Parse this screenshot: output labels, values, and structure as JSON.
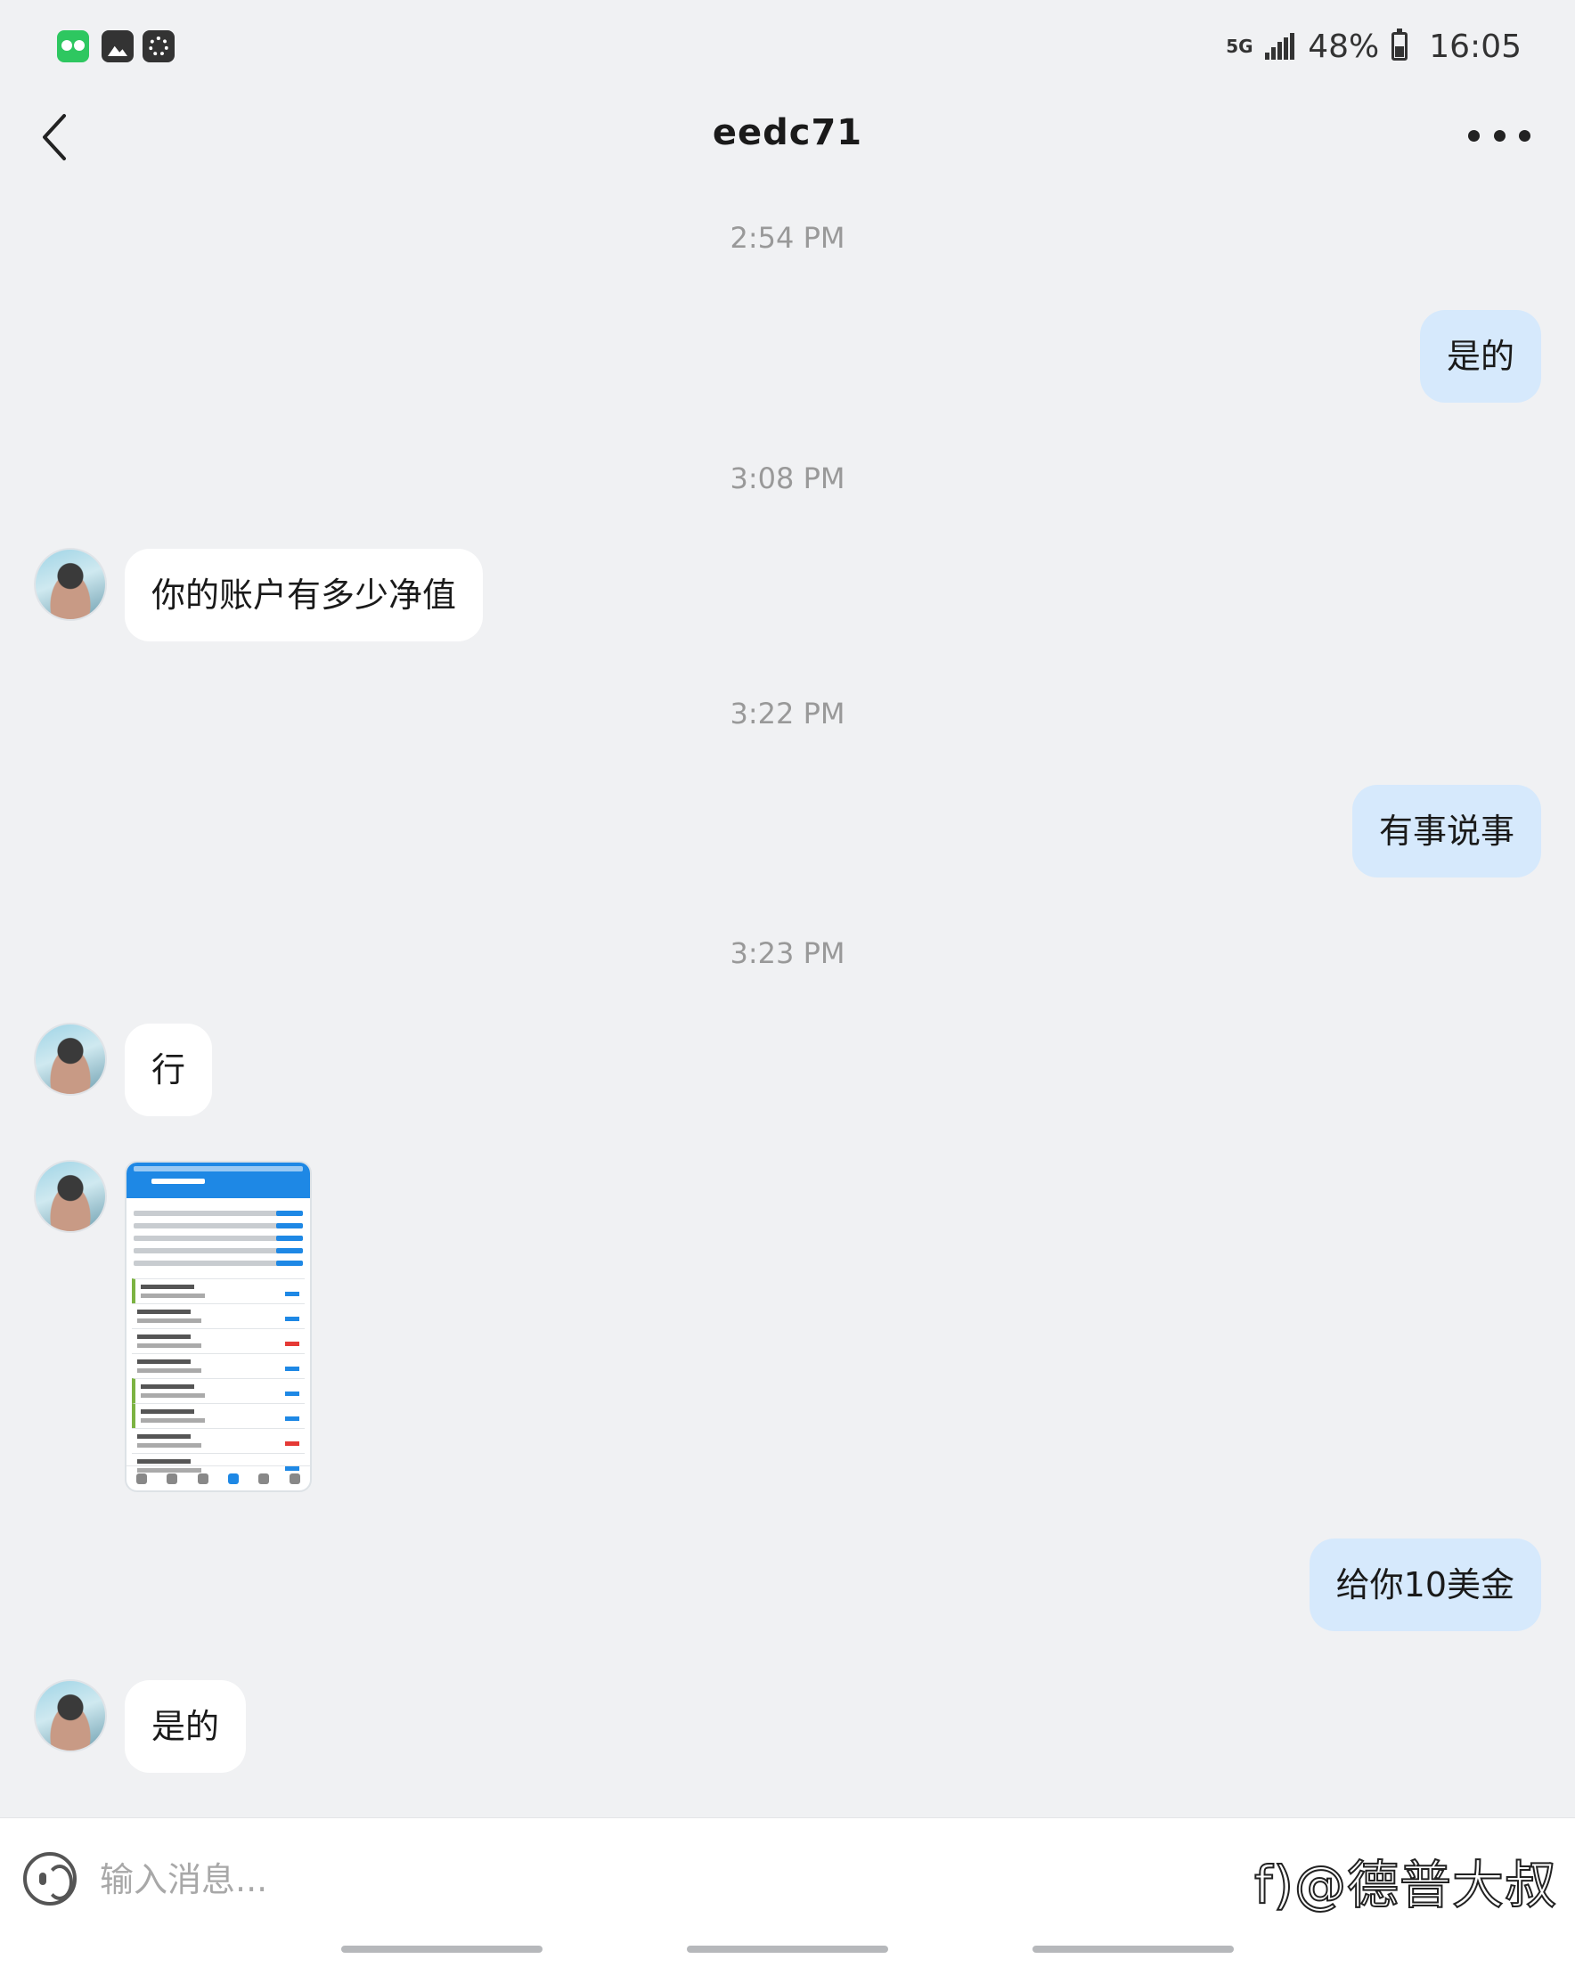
{
  "status_bar": {
    "network": "5G",
    "battery": "48%",
    "battery_level": 0.48,
    "time": "16:05"
  },
  "header": {
    "title": "eedc71"
  },
  "messages": [
    {
      "type": "timestamp",
      "text": "2:54 PM"
    },
    {
      "type": "sent",
      "text": "是的"
    },
    {
      "type": "timestamp",
      "text": "3:08 PM"
    },
    {
      "type": "received",
      "text": "你的账户有多少净值"
    },
    {
      "type": "timestamp",
      "text": "3:22 PM"
    },
    {
      "type": "sent",
      "text": "有事说事"
    },
    {
      "type": "timestamp",
      "text": "3:23 PM"
    },
    {
      "type": "received",
      "text": "行"
    },
    {
      "type": "received_image"
    },
    {
      "type": "sent",
      "text": "给你10美金"
    },
    {
      "type": "received",
      "text": "是的"
    }
  ],
  "input": {
    "placeholder": "输入消息..."
  },
  "watermark": "f)@德普大叔",
  "colors": {
    "sent_bubble": "#d6e9fc",
    "received_bubble": "#ffffff",
    "background": "#f0f1f3"
  }
}
